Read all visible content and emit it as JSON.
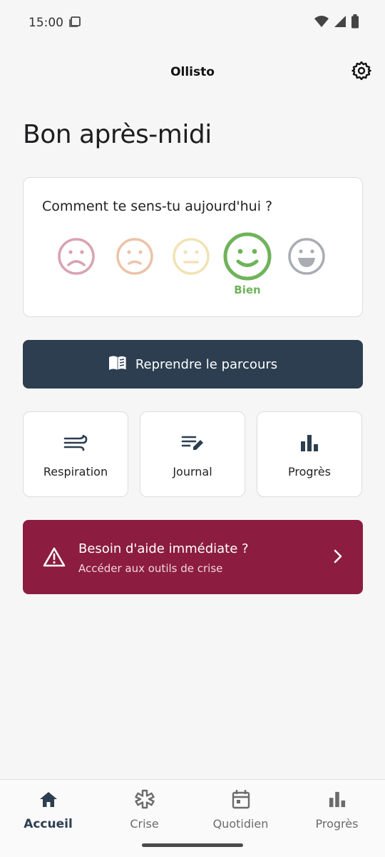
{
  "status_bar": {
    "time": "15:00",
    "icons": [
      "screen-icon",
      "wifi-icon",
      "signal-icon",
      "battery-icon"
    ]
  },
  "app_bar": {
    "title": "Ollisto",
    "settings_icon": "gear-icon"
  },
  "greeting": "Bon après-midi",
  "mood": {
    "question": "Comment te sens-tu aujourd'hui ?",
    "options": [
      {
        "key": "very-sad",
        "color": "#d9a2b0"
      },
      {
        "key": "sad",
        "color": "#ecc3a8"
      },
      {
        "key": "neutral",
        "color": "#f2e3b5"
      },
      {
        "key": "good",
        "color": "#6fb35a"
      },
      {
        "key": "great",
        "color": "#a9adb3"
      }
    ],
    "selected_index": 3,
    "selected_label": "Bien"
  },
  "resume_button": {
    "label": "Reprendre le parcours",
    "icon": "open-book-icon"
  },
  "tiles": [
    {
      "label": "Respiration",
      "icon": "wind-icon"
    },
    {
      "label": "Journal",
      "icon": "edit-note-icon"
    },
    {
      "label": "Progrès",
      "icon": "bar-chart-icon"
    }
  ],
  "crisis": {
    "title": "Besoin d'aide immédiate ?",
    "subtitle": "Accéder aux outils de crise",
    "icon": "warning-icon",
    "chevron": "chevron-right-icon"
  },
  "bottom_nav": {
    "items": [
      {
        "label": "Accueil",
        "icon": "home-icon"
      },
      {
        "label": "Crise",
        "icon": "asterisk-icon"
      },
      {
        "label": "Quotidien",
        "icon": "calendar-icon"
      },
      {
        "label": "Progrès",
        "icon": "bar-chart-icon"
      }
    ],
    "active_index": 0
  },
  "colors": {
    "primary": "#2c3e50",
    "crisis": "#8c1d40",
    "mood_selected": "#6fb35a",
    "background": "#f6f6f6"
  }
}
